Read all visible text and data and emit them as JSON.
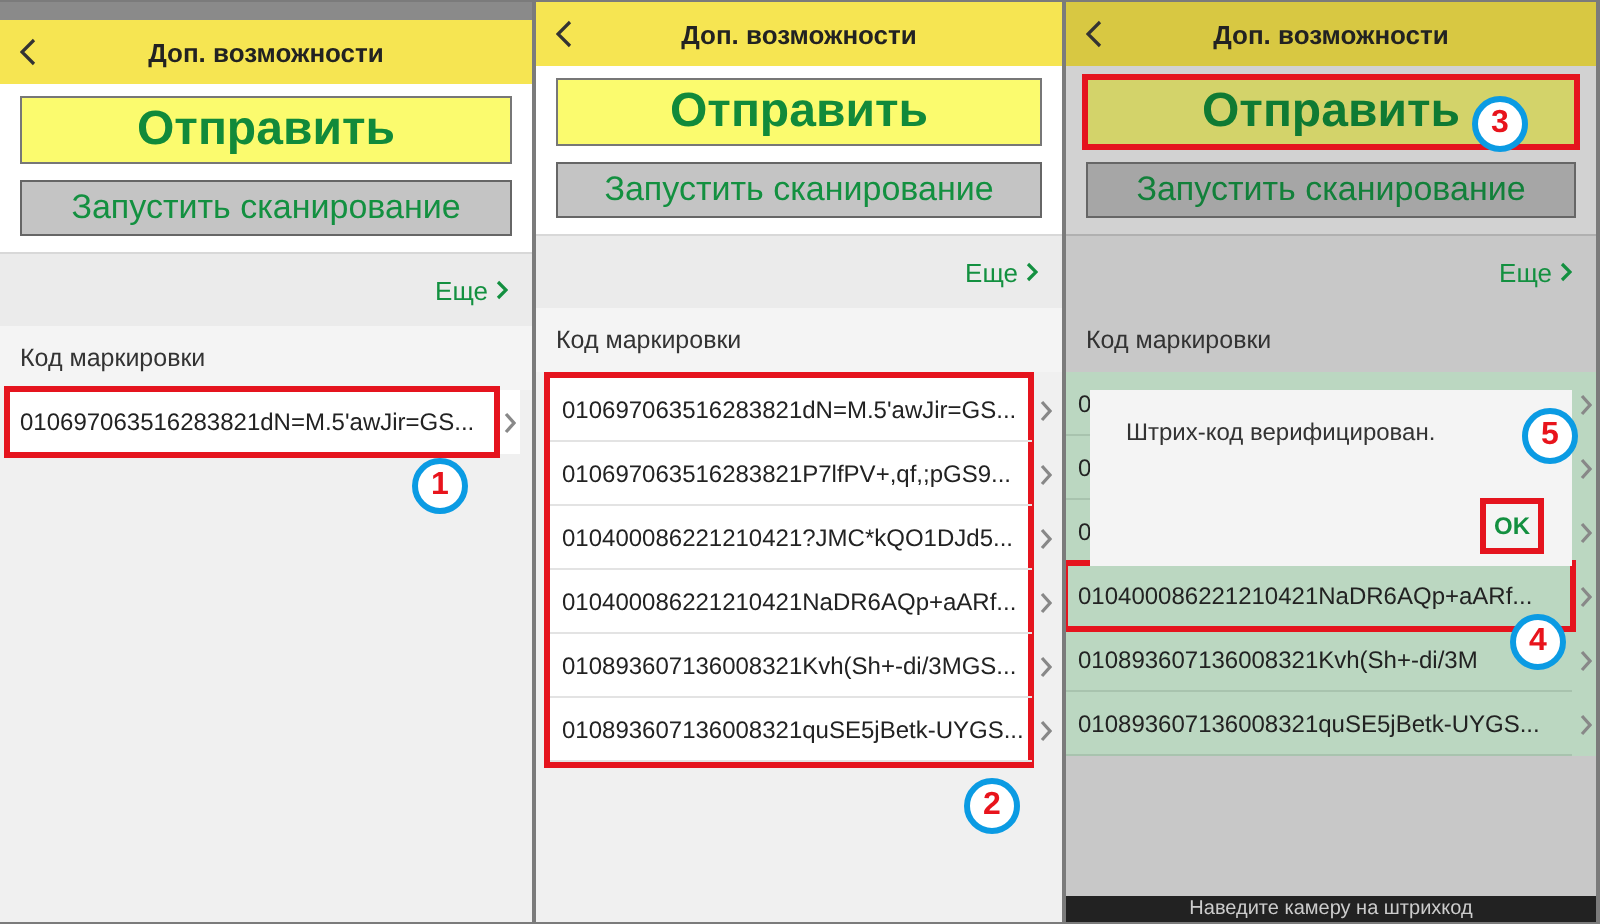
{
  "panels": [
    {
      "status_bar": true,
      "dimmed": false,
      "title": "Доп. возможности",
      "send_button": {
        "label": "Отправить",
        "highlighted": false
      },
      "scan_button": {
        "label": "Запустить сканирование"
      },
      "more_link": "Еще",
      "field_label": "Код маркировки",
      "rows_framed": false,
      "rows": [
        {
          "text": "010697063516283821dN=M.5'awJir=GS...",
          "highlighted": true,
          "callout": "1"
        }
      ]
    },
    {
      "status_bar": false,
      "dimmed": false,
      "title": "Доп. возможности",
      "send_button": {
        "label": "Отправить",
        "highlighted": false
      },
      "scan_button": {
        "label": "Запустить сканирование"
      },
      "more_link": "Еще",
      "field_label": "Код маркировки",
      "rows_framed": true,
      "rows_callout": "2",
      "rows": [
        {
          "text": "010697063516283821dN=M.5'awJir=GS...",
          "highlighted": false
        },
        {
          "text": "010697063516283821P7lfPV+,qf,;pGS9...",
          "highlighted": false
        },
        {
          "text": "010400086221210421?JMC*kQO1DJd5...",
          "highlighted": false
        },
        {
          "text": "010400086221210421NaDR6AQp+aARf...",
          "highlighted": false
        },
        {
          "text": "010893607136008321Kvh(Sh+-di/3MGS...",
          "highlighted": false
        },
        {
          "text": "010893607136008321quSE5jBetk-UYGS...",
          "highlighted": false
        }
      ]
    },
    {
      "status_bar": false,
      "dimmed": true,
      "title": "Доп. возможности",
      "send_button": {
        "label": "Отправить",
        "highlighted": true,
        "callout": "3"
      },
      "scan_button": {
        "label": "Запустить сканирование"
      },
      "more_link": "Еще",
      "field_label": "Код маркировки",
      "rows_framed": false,
      "rows": [
        {
          "text": "0",
          "highlighted": false
        },
        {
          "text": "0",
          "highlighted": false
        },
        {
          "text": "0",
          "highlighted": false
        },
        {
          "text": "010400086221210421NaDR6AQp+aARf...",
          "highlighted": true,
          "callout": "4"
        },
        {
          "text": "010893607136008321Kvh(Sh+-di/3M",
          "highlighted": false
        },
        {
          "text": "010893607136008321quSE5jBetk-UYGS...",
          "highlighted": false
        }
      ],
      "dialog": {
        "message": "Штрих-код верифицирован.",
        "ok_button": {
          "label": "OK",
          "highlighted": true,
          "callout": "5"
        }
      },
      "bottom_hint": "Наведите камеру на штрихкод"
    }
  ]
}
